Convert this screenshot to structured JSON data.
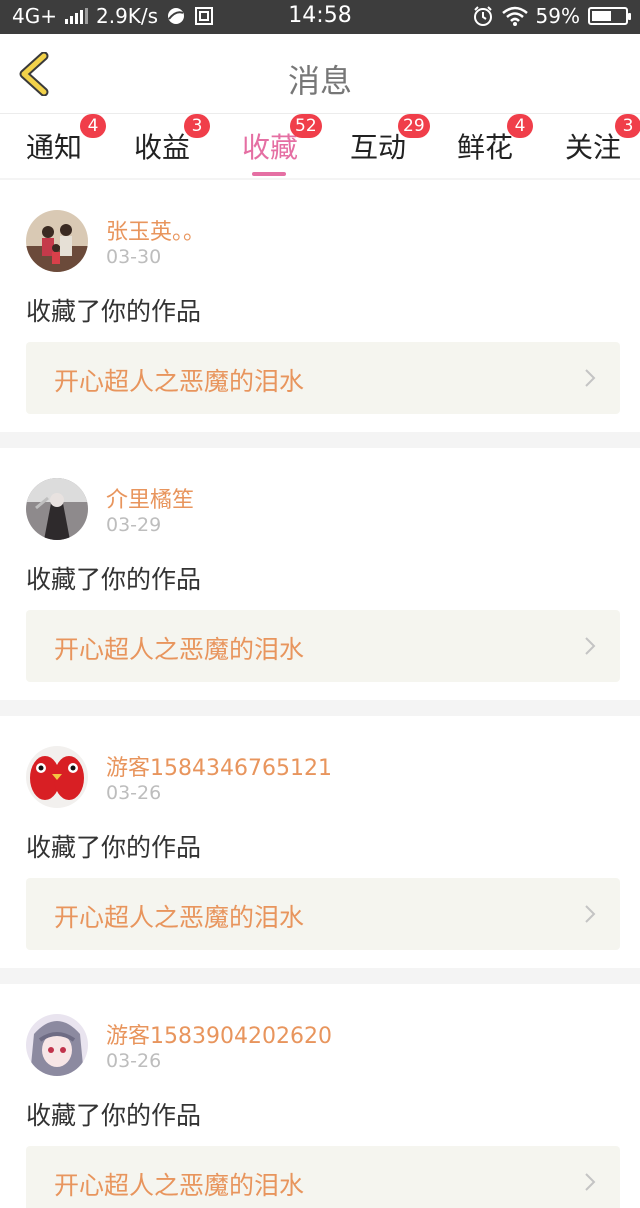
{
  "status_bar": {
    "network": "4G+",
    "speed": "2.9K/s",
    "time": "14:58",
    "battery": "59%",
    "battery_level": 0.59
  },
  "header": {
    "title": "消息"
  },
  "tabs": [
    {
      "label": "通知",
      "badge": "4"
    },
    {
      "label": "收益",
      "badge": "3"
    },
    {
      "label": "收藏",
      "badge": "52",
      "active": true
    },
    {
      "label": "互动",
      "badge": "29"
    },
    {
      "label": "鲜花",
      "badge": "4"
    },
    {
      "label": "关注",
      "badge": "3"
    }
  ],
  "messages": [
    {
      "username": "张玉英。。",
      "date": "03-30",
      "action": "收藏了你的作品",
      "work_title": "开心超人之恶魔的泪水"
    },
    {
      "username": "介里橘笙",
      "date": "03-29",
      "action": "收藏了你的作品",
      "work_title": "开心超人之恶魔的泪水"
    },
    {
      "username": "游客1584346765121",
      "date": "03-26",
      "action": "收藏了你的作品",
      "work_title": "开心超人之恶魔的泪水"
    },
    {
      "username": "游客1583904202620",
      "date": "03-26",
      "action": "收藏了你的作品",
      "work_title": "开心超人之恶魔的泪水"
    }
  ],
  "colors": {
    "accent_pink": "#e56fa3",
    "username_orange": "#e8955d",
    "badge_red": "#f03e4a",
    "back_yellow": "#f2d24a"
  }
}
